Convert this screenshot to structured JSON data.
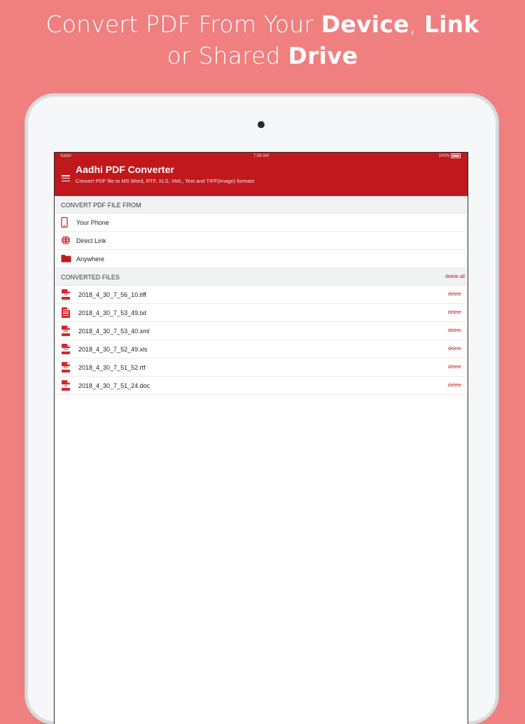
{
  "headline": {
    "line1_prefix": "Convert PDF From Your ",
    "line1_bold1": "Device",
    "line1_sep": ", ",
    "line1_bold2": "Link",
    "line2_prefix": "or Shared ",
    "line2_bold": "Drive"
  },
  "status_bar": {
    "carrier": "Safari",
    "time": "7:58 AM",
    "battery": "100%"
  },
  "app": {
    "title": "Aadhi PDF Converter",
    "subtitle": "Convert PDF file to MS Word, RTF, XLS, XML, Text and TIFF(Image) formats",
    "menu_icon": "hamburger-menu-icon"
  },
  "convert_section": {
    "header": "CONVERT PDF FILE FROM",
    "items": [
      {
        "label": "Your Phone",
        "icon": "phone-icon"
      },
      {
        "label": "Direct Link",
        "icon": "globe-icon"
      },
      {
        "label": "Anywhere",
        "icon": "folder-icon"
      }
    ]
  },
  "converted_section": {
    "header": "CONVERTED FILES",
    "delete_all_label": "delete all",
    "files": [
      {
        "name": "2018_4_30_7_56_10.tiff",
        "icon": "tiff-file-icon",
        "tag": "TIF",
        "delete_label": "delete"
      },
      {
        "name": "2018_4_30_7_53_49.txt",
        "icon": "txt-file-icon",
        "tag": "",
        "delete_label": "delete"
      },
      {
        "name": "2018_4_30_7_53_40.xml",
        "icon": "xml-file-icon",
        "tag": "XML",
        "delete_label": "delete"
      },
      {
        "name": "2018_4_30_7_52_49.xls",
        "icon": "xls-file-icon",
        "tag": "XLS",
        "delete_label": "delete"
      },
      {
        "name": "2018_4_30_7_51_52.rtf",
        "icon": "rtf-file-icon",
        "tag": "RTF",
        "delete_label": "delete"
      },
      {
        "name": "2018_4_30_7_51_24.doc",
        "icon": "doc-file-icon",
        "tag": "W",
        "delete_label": "delete"
      }
    ]
  },
  "colors": {
    "background": "#f07f80",
    "app_bar": "#c0181c",
    "accent": "#c0181c"
  }
}
